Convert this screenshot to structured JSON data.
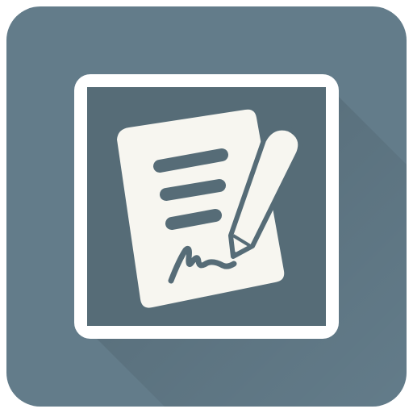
{
  "app_icon": {
    "icon_name": "document-signature-icon",
    "description_terms": [
      "document",
      "pen",
      "signature"
    ],
    "colors": {
      "tile": "#637C8A",
      "tile_shadow": "#567080",
      "frame": "#FFFFFF",
      "inner_panel": "#566C77",
      "paper": "#F7F6F0",
      "paper_text_lines": "#566C77",
      "pencil": "#F7F6F0",
      "signature": "#F7F6F0"
    }
  }
}
